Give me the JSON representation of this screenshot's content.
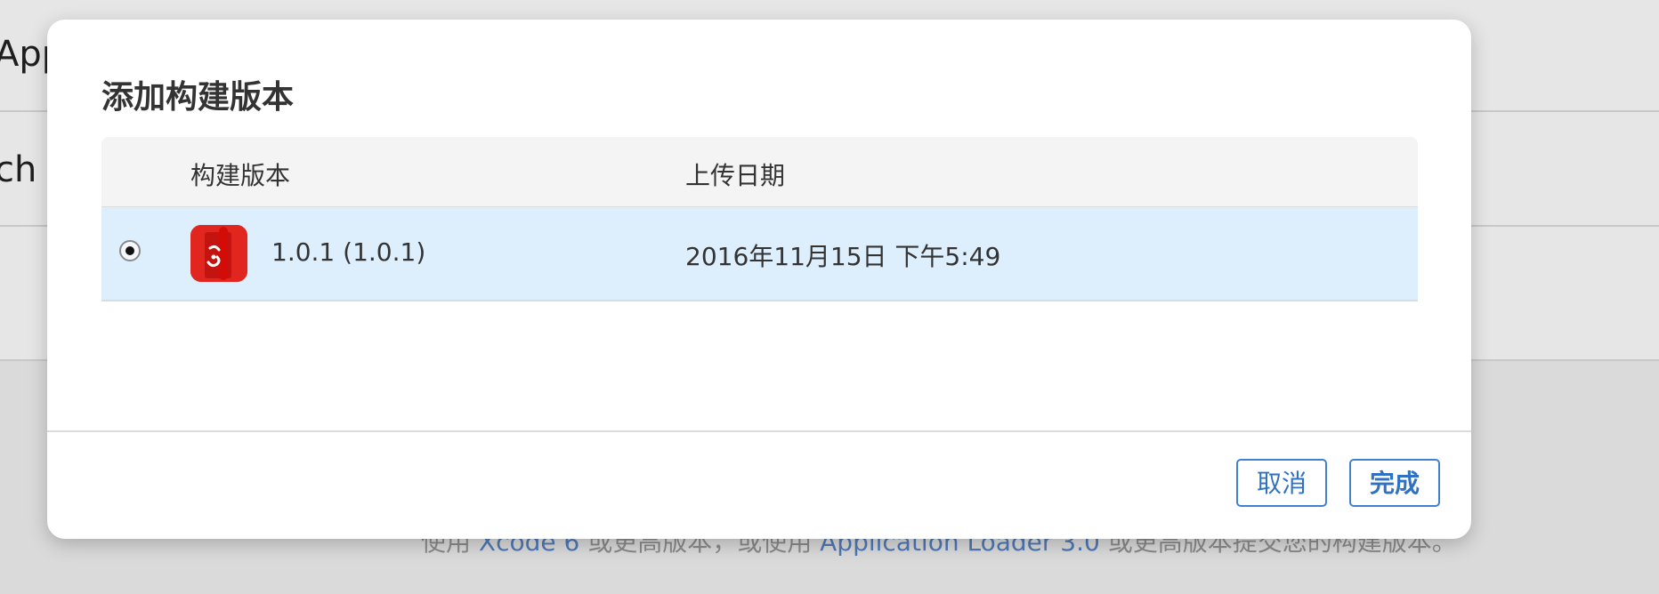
{
  "background": {
    "row1_text": "App",
    "row2_text": "ch",
    "hint": {
      "prefix": "使用 ",
      "link1": "Xcode 6",
      "middle": " 或更高版本，或使用 ",
      "link2": "Application Loader 3.0",
      "suffix": " 或更高版本提交您的构建版本。"
    }
  },
  "modal": {
    "title": "添加构建版本",
    "table": {
      "headers": {
        "build": "构建版本",
        "upload_date": "上传日期"
      },
      "rows": [
        {
          "selected": true,
          "icon": "app-icon",
          "version": "1.0.1 (1.0.1)",
          "upload_date": "2016年11月15日 下午5:49"
        }
      ]
    },
    "buttons": {
      "cancel": "取消",
      "done": "完成"
    }
  },
  "colors": {
    "accent": "#2f72c4",
    "row_selected_bg": "#ddeefc",
    "app_icon_bg": "#e0261e"
  }
}
